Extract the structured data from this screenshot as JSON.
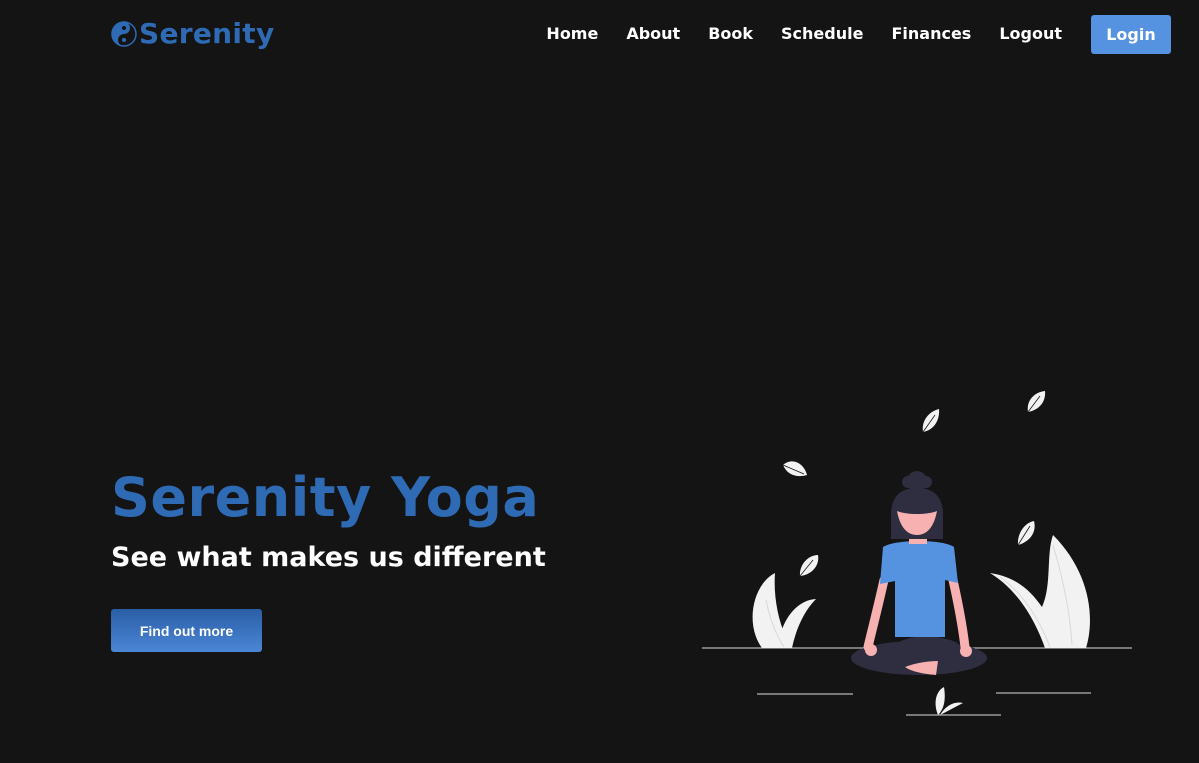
{
  "brand": {
    "name": "Serenity",
    "color": "#2f6bb5",
    "icon": "yin-yang-icon"
  },
  "nav": {
    "items": [
      {
        "label": "Home"
      },
      {
        "label": "About"
      },
      {
        "label": "Book"
      },
      {
        "label": "Schedule"
      },
      {
        "label": "Finances"
      },
      {
        "label": "Logout"
      }
    ],
    "login_label": "Login",
    "login_color": "#5592e0"
  },
  "hero": {
    "title": "Serenity Yoga",
    "subtitle": "See what makes us different",
    "cta_label": "Find out more"
  },
  "illustration": {
    "subject": "meditating-person-icon",
    "shirt_color": "#5592e0",
    "skin_color": "#f7b1b0",
    "hair_color": "#2f2e41",
    "leaf_color": "#f2f2f2"
  },
  "theme": {
    "background": "#141414",
    "text": "#ffffff"
  }
}
